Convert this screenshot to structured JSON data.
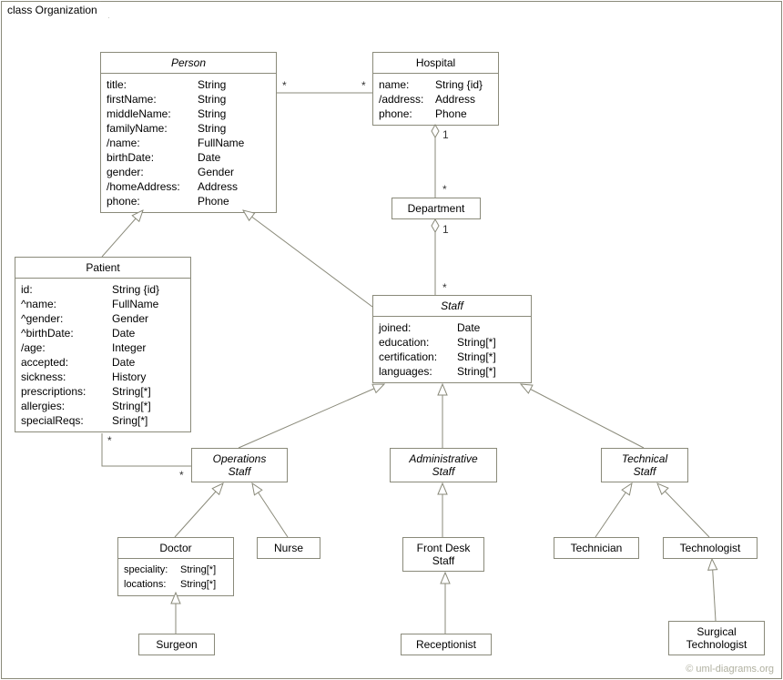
{
  "frame": {
    "label": "class Organization"
  },
  "classes": {
    "person": {
      "name": "Person",
      "attrs": [
        {
          "name": "title:",
          "type": "String"
        },
        {
          "name": "firstName:",
          "type": "String"
        },
        {
          "name": "middleName:",
          "type": "String"
        },
        {
          "name": "familyName:",
          "type": "String"
        },
        {
          "name": "/name:",
          "type": "FullName"
        },
        {
          "name": "birthDate:",
          "type": "Date"
        },
        {
          "name": "gender:",
          "type": "Gender"
        },
        {
          "name": "/homeAddress:",
          "type": "Address"
        },
        {
          "name": "phone:",
          "type": "Phone"
        }
      ]
    },
    "hospital": {
      "name": "Hospital",
      "attrs": [
        {
          "name": "name:",
          "type": "String {id}"
        },
        {
          "name": "/address:",
          "type": "Address"
        },
        {
          "name": "phone:",
          "type": "Phone"
        }
      ]
    },
    "department": {
      "name": "Department"
    },
    "patient": {
      "name": "Patient",
      "attrs": [
        {
          "name": "id:",
          "type": "String {id}"
        },
        {
          "name": "^name:",
          "type": "FullName"
        },
        {
          "name": "^gender:",
          "type": "Gender"
        },
        {
          "name": "^birthDate:",
          "type": "Date"
        },
        {
          "name": "/age:",
          "type": "Integer"
        },
        {
          "name": "accepted:",
          "type": "Date"
        },
        {
          "name": "sickness:",
          "type": "History"
        },
        {
          "name": "prescriptions:",
          "type": "String[*]"
        },
        {
          "name": "allergies:",
          "type": "String[*]"
        },
        {
          "name": "specialReqs:",
          "type": "Sring[*]"
        }
      ]
    },
    "staff": {
      "name": "Staff",
      "attrs": [
        {
          "name": "joined:",
          "type": "Date"
        },
        {
          "name": "education:",
          "type": "String[*]"
        },
        {
          "name": "certification:",
          "type": "String[*]"
        },
        {
          "name": "languages:",
          "type": "String[*]"
        }
      ]
    },
    "operationsStaff": {
      "name_line1": "Operations",
      "name_line2": "Staff"
    },
    "administrativeStaff": {
      "name_line1": "Administrative",
      "name_line2": "Staff"
    },
    "technicalStaff": {
      "name_line1": "Technical",
      "name_line2": "Staff"
    },
    "doctor": {
      "name": "Doctor",
      "attrs": [
        {
          "name": "speciality:",
          "type": "String[*]"
        },
        {
          "name": "locations:",
          "type": "String[*]"
        }
      ]
    },
    "nurse": {
      "name": "Nurse"
    },
    "frontDeskStaff": {
      "name_line1": "Front Desk",
      "name_line2": "Staff"
    },
    "receptionist": {
      "name": "Receptionist"
    },
    "technician": {
      "name": "Technician"
    },
    "technologist": {
      "name": "Technologist"
    },
    "surgicalTechnologist": {
      "name_line1": "Surgical",
      "name_line2": "Technologist"
    },
    "surgeon": {
      "name": "Surgeon"
    }
  },
  "multiplicities": {
    "person_hospital_left": "*",
    "person_hospital_right": "*",
    "hospital_dept_top": "1",
    "hospital_dept_bottom": "*",
    "dept_staff_top": "1",
    "dept_staff_bottom": "*",
    "patient_ops_left": "*",
    "patient_ops_right": "*"
  },
  "watermark": "© uml-diagrams.org"
}
